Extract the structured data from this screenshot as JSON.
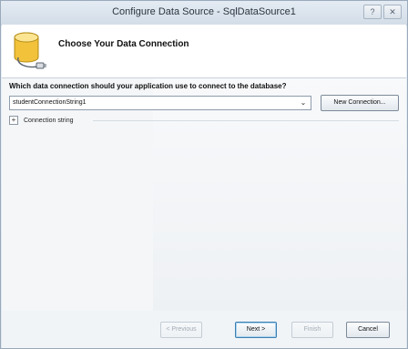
{
  "window": {
    "title": "Configure Data Source - SqlDataSource1",
    "help_glyph": "?",
    "close_glyph": "✕"
  },
  "header": {
    "title": "Choose Your Data Connection",
    "icon": "database-icon"
  },
  "main": {
    "question": "Which data connection should your application use to connect to the database?",
    "connection_value": "studentConnectionString1",
    "dropdown_glyph": "⌄",
    "new_connection_label": "New Connection...",
    "expander_glyph": "+",
    "expander_label": "Connection string"
  },
  "footer": {
    "previous_label": "< Previous",
    "next_label": "Next >",
    "finish_label": "Finish",
    "cancel_label": "Cancel"
  },
  "colors": {
    "accent": "#3c7fb1",
    "database_gold": "#f1c23a"
  }
}
